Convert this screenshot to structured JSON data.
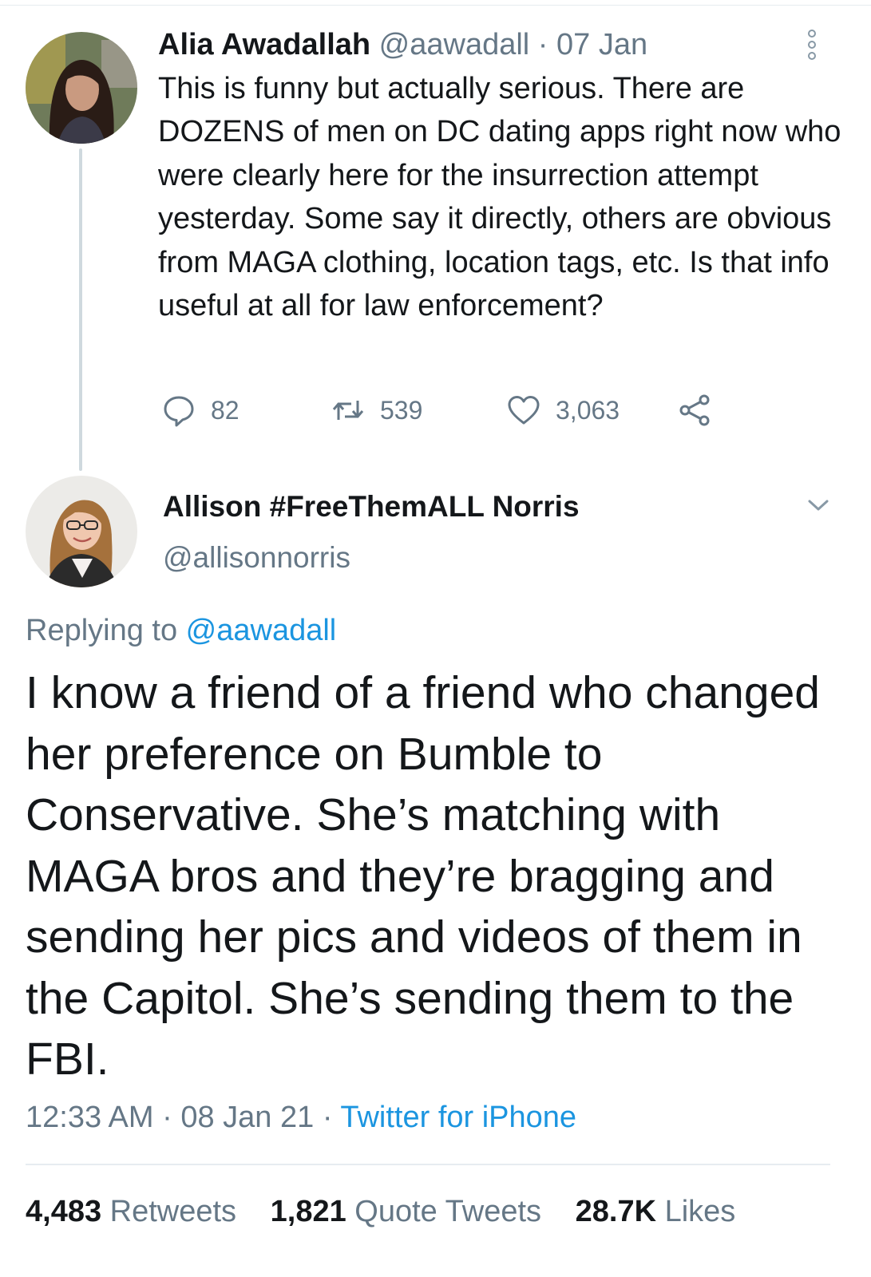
{
  "parent_tweet": {
    "name": "Alia Awadallah",
    "handle": "@aawadall",
    "separator": "·",
    "date": "07 Jan",
    "text": "This is funny but actually serious. There are DOZENS of men on DC dating apps right now who were clearly here for the insurrection attempt yesterday. Some say it directly, others are obvious from MAGA clothing, location tags, etc. Is that info useful at all for law enforcement?",
    "replies": "82",
    "retweets": "539",
    "likes": "3,063"
  },
  "main_tweet": {
    "name": "Allison #FreeThemALL Norris",
    "handle": "@allisonnorris",
    "replying_prefix": "Replying to ",
    "replying_handle": "@aawadall",
    "text": "I know a friend of a friend who changed her preference on Bumble to Conservative. She’s matching with MAGA bros and they’re bragging and sending her pics and videos of them in the Capitol. She’s sending them to the FBI.",
    "time": "12:33 AM",
    "date": "08 Jan 21",
    "separator": " · ",
    "source": "Twitter for iPhone"
  },
  "stats": {
    "retweets_count": "4,483",
    "retweets_label": "Retweets",
    "quotes_count": "1,821",
    "quotes_label": "Quote Tweets",
    "likes_count": "28.7K",
    "likes_label": "Likes"
  },
  "colors": {
    "text": "#14171a",
    "secondary": "#657786",
    "link": "#1b95e0",
    "divider": "#e6ecf0"
  },
  "icons": [
    "more-vertical-icon",
    "reply-icon",
    "retweet-icon",
    "like-icon",
    "share-icon",
    "chevron-down-icon"
  ]
}
